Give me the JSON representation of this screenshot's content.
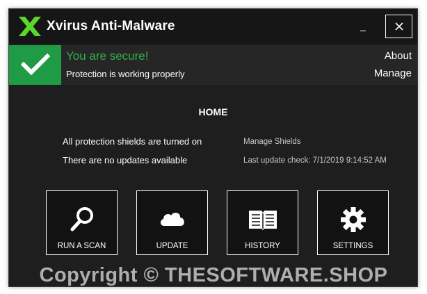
{
  "window": {
    "title": "Xvirus Anti-Malware",
    "close_label": "✕",
    "minimize_label": "_"
  },
  "status": {
    "title": "You are secure!",
    "subtitle": "Protection is working properly",
    "about_label": "About",
    "manage_label": "Manage",
    "accent_color": "#1f9a45"
  },
  "home": {
    "title": "HOME",
    "shields_text": "All protection shields are turned on",
    "manage_shields_label": "Manage Shields",
    "updates_text": "There are no updates available",
    "last_update_text": "Last update check: 7/1/2019 9:14:52 AM"
  },
  "tiles": [
    {
      "label": "RUN A SCAN",
      "icon": "magnifier-icon"
    },
    {
      "label": "UPDATE",
      "icon": "cloud-icon"
    },
    {
      "label": "HISTORY",
      "icon": "book-icon"
    },
    {
      "label": "SETTINGS",
      "icon": "gear-icon"
    }
  ],
  "watermark": "Copyright © THESOFTWARE.SHOP"
}
